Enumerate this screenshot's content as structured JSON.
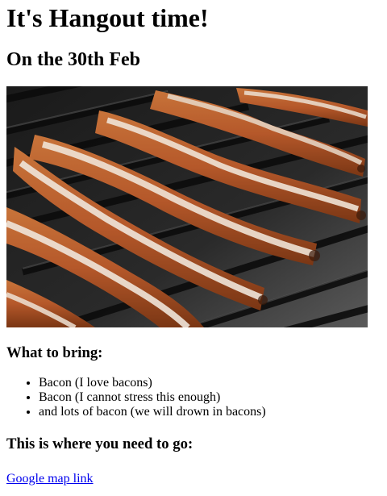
{
  "heading": "It's Hangout time!",
  "date_heading": "On the 30th Feb",
  "photo": {
    "description": "bacon strips cooking on a grill"
  },
  "bring": {
    "title": "What to bring:",
    "items": [
      "Bacon (I love bacons)",
      "Bacon (I cannot stress this enough)",
      "and lots of bacon (we will drown in bacons)"
    ]
  },
  "location": {
    "title": "This is where you need to go:",
    "link_text": "Google map link"
  },
  "colors": {
    "link": "#0000ee",
    "text": "#000000"
  }
}
